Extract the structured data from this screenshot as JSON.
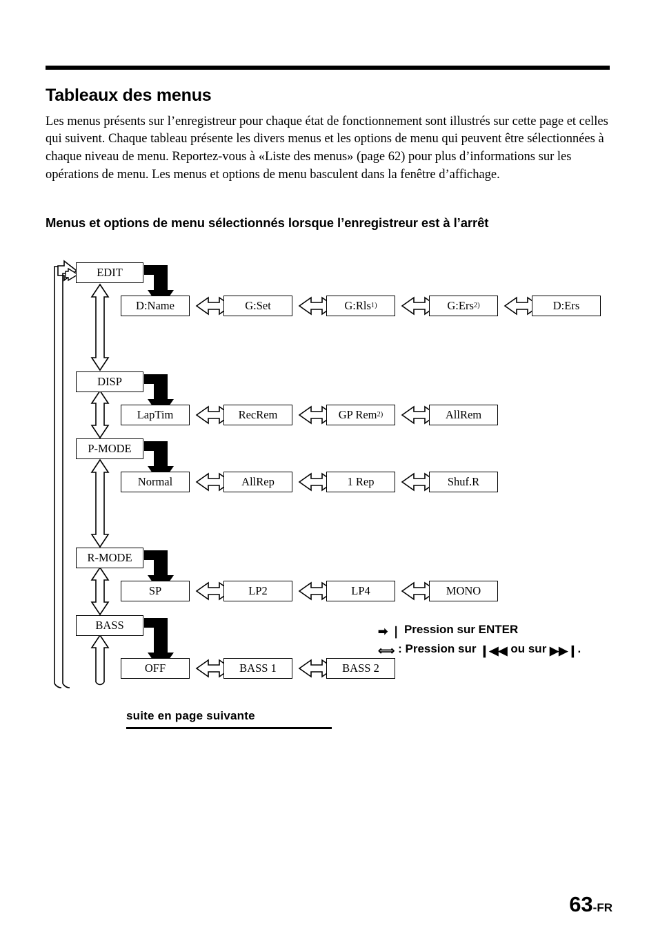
{
  "page": {
    "title": "Tableaux des menus",
    "intro": "Les menus présents sur l’enregistreur pour chaque état de fonctionnement sont illustrés sur cette page et celles qui suivent. Chaque tableau présente les divers menus et les options de menu qui peuvent être sélectionnées à chaque niveau de menu. Reportez-vous à «Liste des menus» (page 62) pour plus d’informations sur les opérations de menu. Les menus et options de menu basculent dans la fenêtre d’affichage.",
    "section_title": "Menus et options de menu sélectionnés lorsque l’enregistreur est à l’arrêt",
    "continued_note": "suite en page suivante",
    "folio_number": "63",
    "folio_suffix": "-FR"
  },
  "legend": {
    "enter_arrow_glyph": "➡",
    "enter_bar_glyph": "❘",
    "enter_text": "Pression sur ENTER",
    "lr_arrow_glyph": "⟺",
    "lr_text_before": ": Pression sur",
    "prev_glyph": "❙◀◀",
    "lr_text_middle": "ou sur",
    "next_glyph": "▶▶❙",
    "lr_text_end": "."
  },
  "menus": [
    {
      "name": "EDIT",
      "options": [
        {
          "label": "D:Name",
          "sup": ""
        },
        {
          "label": "G:Set",
          "sup": ""
        },
        {
          "label": "G:Rls",
          "sup": "1)"
        },
        {
          "label": "G:Ers",
          "sup": "2)"
        },
        {
          "label": "D:Ers",
          "sup": ""
        }
      ]
    },
    {
      "name": "DISP",
      "options": [
        {
          "label": "LapTim",
          "sup": ""
        },
        {
          "label": "RecRem",
          "sup": ""
        },
        {
          "label": "GP Rem",
          "sup": "2)"
        },
        {
          "label": "AllRem",
          "sup": ""
        }
      ]
    },
    {
      "name": "P-MODE",
      "options": [
        {
          "label": "Normal",
          "sup": ""
        },
        {
          "label": "AllRep",
          "sup": ""
        },
        {
          "label": "1 Rep",
          "sup": ""
        },
        {
          "label": "Shuf.R",
          "sup": ""
        }
      ]
    },
    {
      "name": "R-MODE",
      "options": [
        {
          "label": "SP",
          "sup": ""
        },
        {
          "label": "LP2",
          "sup": ""
        },
        {
          "label": "LP4",
          "sup": ""
        },
        {
          "label": "MONO",
          "sup": ""
        }
      ]
    },
    {
      "name": "BASS",
      "options": [
        {
          "label": "OFF",
          "sup": ""
        },
        {
          "label": "BASS 1",
          "sup": ""
        },
        {
          "label": "BASS 2",
          "sup": ""
        }
      ]
    }
  ],
  "colors": {
    "ink": "#000000",
    "paper": "#ffffff"
  }
}
